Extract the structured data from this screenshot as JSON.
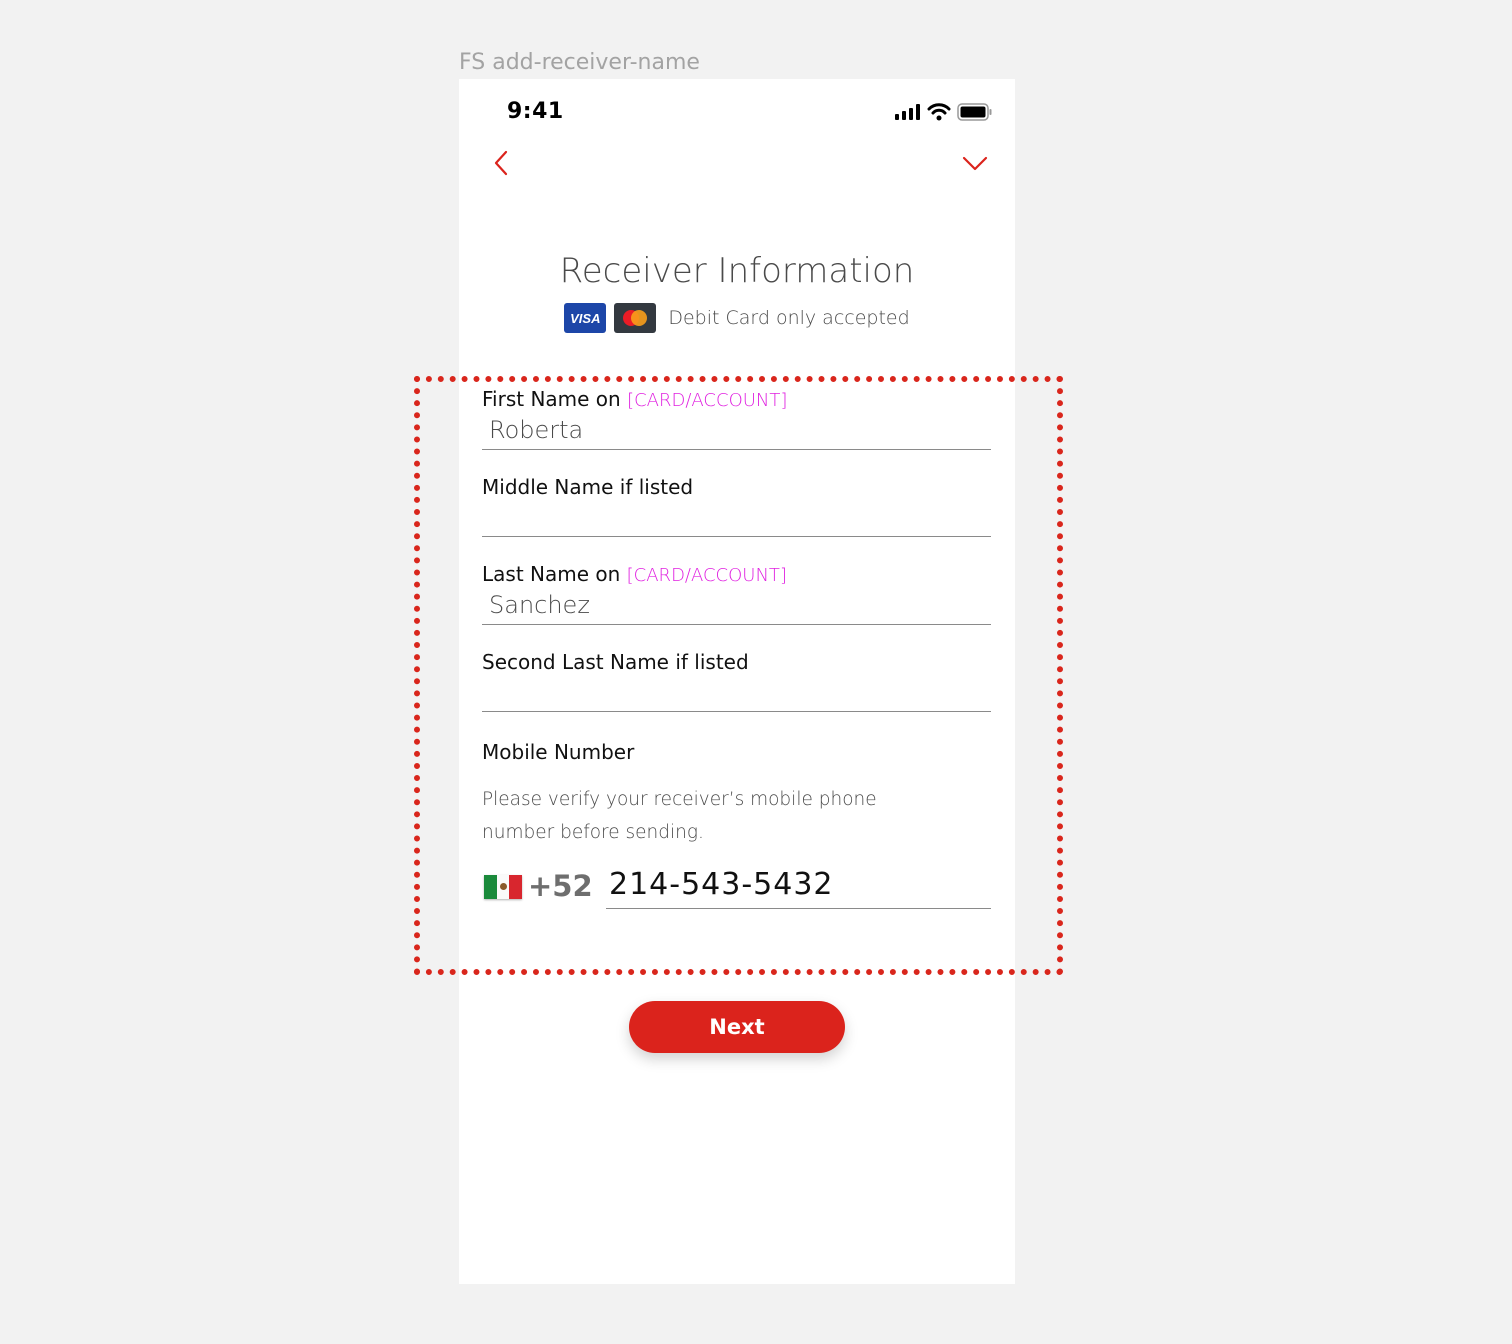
{
  "frame_label": "FS add-receiver-name",
  "status_bar": {
    "time": "9:41"
  },
  "header": {
    "title": "Receiver Information",
    "card_note": "Debit Card only accepted",
    "visa_label": "VISA"
  },
  "form": {
    "first_name": {
      "label": "First Name on",
      "tag": "[CARD/ACCOUNT]",
      "value": "Roberta"
    },
    "middle_name": {
      "label": "Middle Name if listed",
      "value": ""
    },
    "last_name": {
      "label": "Last Name on",
      "tag": "[CARD/ACCOUNT]",
      "value": "Sanchez"
    },
    "second_last_name": {
      "label": "Second Last Name if listed",
      "value": ""
    },
    "mobile": {
      "label": "Mobile Number",
      "helper": "Please verify your receiver’s mobile phone number before sending.",
      "country_code": "+52",
      "value": "214-543-5432"
    }
  },
  "actions": {
    "next_label": "Next"
  },
  "colors": {
    "accent": "#db231c",
    "tag": "#e020e0",
    "visa": "#1d46a8"
  }
}
